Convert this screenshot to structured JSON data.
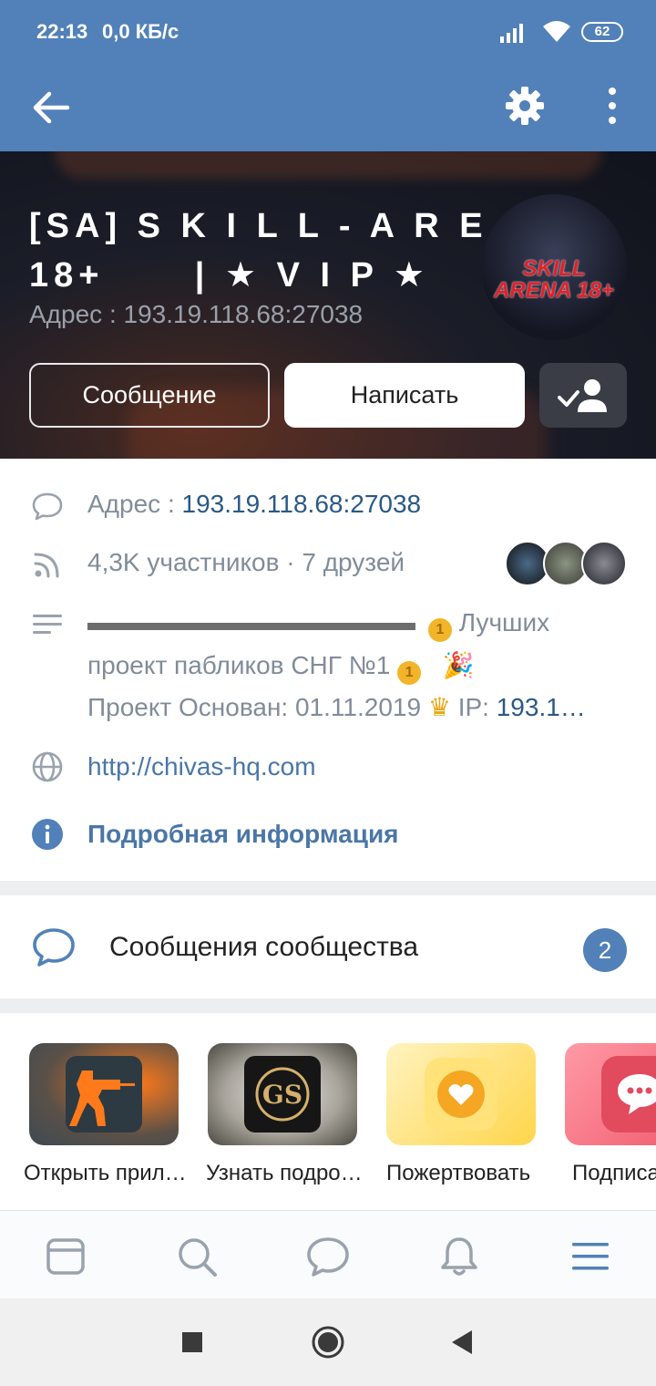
{
  "status_bar": {
    "time": "22:13",
    "net_speed": "0,0 КБ/с",
    "battery": "62"
  },
  "toolbar": {
    "back_icon": "arrow-left-icon",
    "settings_icon": "gear-icon",
    "more_icon": "more-vertical-icon"
  },
  "cover": {
    "title": "[SA] S K I L L - A R E N A\n18+      | ★ V I P ★",
    "address": "Адрес : 193.19.118.68:27038",
    "avatar_logo": "SKILL ARENA 18+",
    "buttons": {
      "message": "Сообщение",
      "write": "Написать"
    }
  },
  "info": {
    "address_label": "Адрес : ",
    "address_value": "193.19.118.68:27038",
    "members": "4,3K участников · 7 друзей",
    "desc_line1": "Лучших",
    "desc_line2": "проект пабликов СНГ №1",
    "desc_line3": "Проект Основан: 01.11.2019",
    "desc_line3_ip": "IP: ",
    "desc_line3_ip_value": "193.1…",
    "website": "http://chivas-hq.com",
    "more_info": "Подробная информация"
  },
  "community_messages": {
    "label": "Сообщения сообщества",
    "count": "2"
  },
  "apps": [
    {
      "label": "Открыть прил…"
    },
    {
      "label": "Узнать подро…"
    },
    {
      "label": "Пожертвовать"
    },
    {
      "label": "Подписа"
    }
  ],
  "colors": {
    "brand": "#5181b8",
    "link": "#2a5885",
    "muted": "#818c99"
  }
}
